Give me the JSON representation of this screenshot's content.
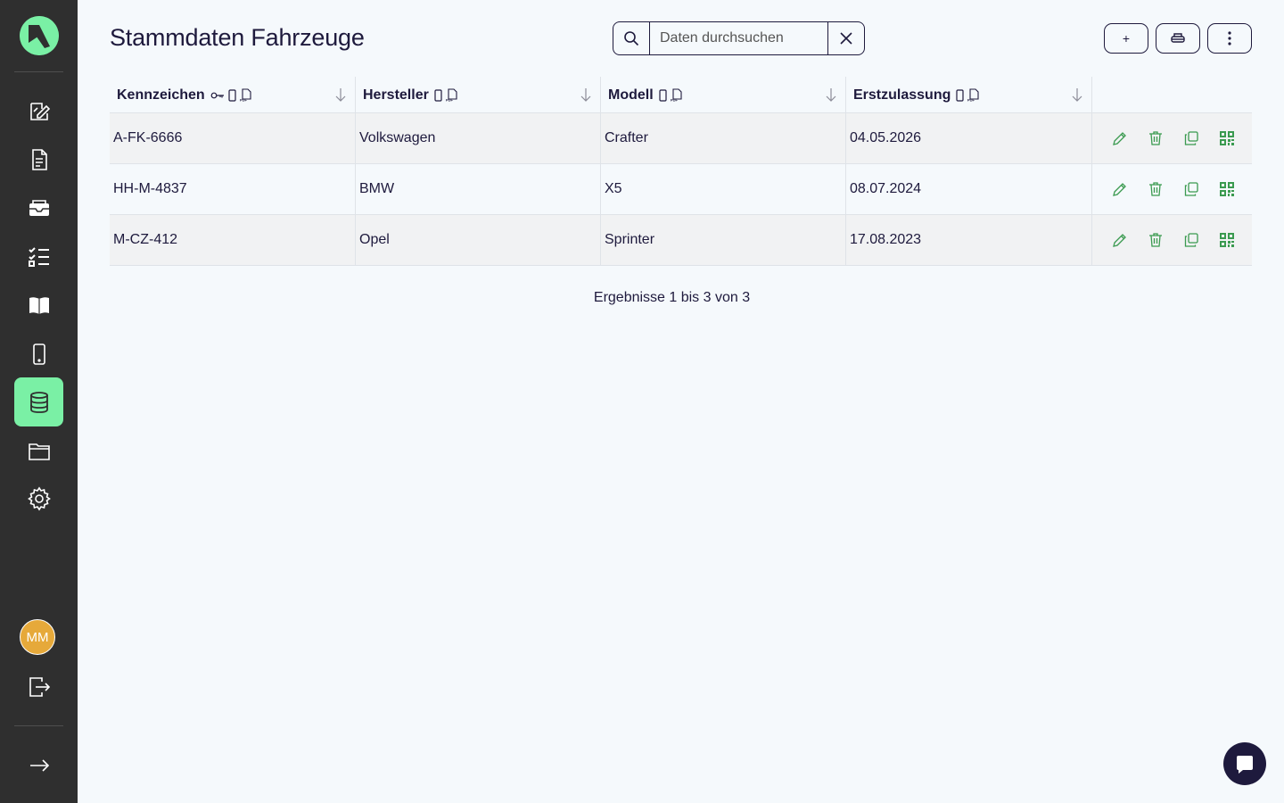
{
  "app": {
    "avatar_initials": "MM",
    "accent_color": "#7af0a5",
    "sidebar_bg": "#2f2f2f"
  },
  "sidebar": {
    "items": [
      {
        "icon": "edit-form-icon"
      },
      {
        "icon": "document-icon"
      },
      {
        "icon": "inbox-icon"
      },
      {
        "icon": "checklist-icon"
      },
      {
        "icon": "book-icon"
      },
      {
        "icon": "mobile-icon"
      },
      {
        "icon": "database-icon",
        "active": true
      },
      {
        "icon": "folder-icon"
      },
      {
        "icon": "gear-icon"
      }
    ],
    "bottom": [
      {
        "icon": "logout-icon"
      },
      {
        "icon": "expand-arrow-icon"
      }
    ]
  },
  "header": {
    "title": "Stammdaten Fahrzeuge",
    "search_placeholder": "Daten durchsuchen",
    "search_value": "",
    "buttons": [
      {
        "name": "add-button",
        "label": "+"
      },
      {
        "name": "print-button",
        "icon": "printer-icon"
      },
      {
        "name": "more-button",
        "icon": "more-vertical-icon"
      }
    ]
  },
  "table": {
    "columns": [
      {
        "label": "Kennzeichen",
        "key_icon": true
      },
      {
        "label": "Hersteller"
      },
      {
        "label": "Modell"
      },
      {
        "label": "Erstzulassung"
      }
    ],
    "rows": [
      [
        "A-FK-6666",
        "Volkswagen",
        "Crafter",
        "04.05.2026"
      ],
      [
        "HH-M-4837",
        "BMW",
        "X5",
        "08.07.2024"
      ],
      [
        "M-CZ-412",
        "Opel",
        "Sprinter",
        "17.08.2023"
      ]
    ],
    "row_actions": [
      "edit-icon",
      "delete-icon",
      "copy-icon",
      "qr-code-icon"
    ],
    "action_color": "#3a9a4f"
  },
  "pagination": {
    "summary": "Ergebnisse 1 bis 3 von 3"
  }
}
